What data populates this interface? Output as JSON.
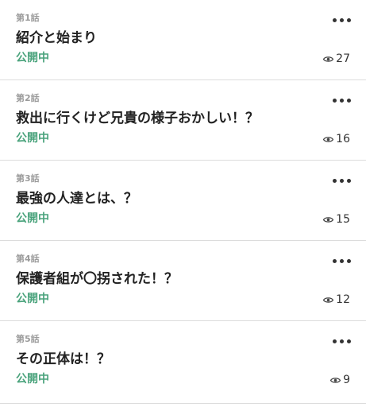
{
  "colors": {
    "status": "#4aa37c",
    "divider": "#dcdcdc",
    "episode_number": "#9b9b9b"
  },
  "icons": {
    "more": "more-horizontal-icon",
    "views": "eye-icon"
  },
  "episodes": [
    {
      "number": "第1話",
      "title": "紹介と始まり",
      "status": "公開中",
      "views": "27"
    },
    {
      "number": "第2話",
      "title": "救出に行くけど兄貴の様子おかしい！？",
      "status": "公開中",
      "views": "16"
    },
    {
      "number": "第3話",
      "title": "最強の人達とは、？",
      "status": "公開中",
      "views": "15"
    },
    {
      "number": "第4話",
      "title": "保護者組が〇拐された！？",
      "status": "公開中",
      "views": "12"
    },
    {
      "number": "第5話",
      "title": "その正体は！？",
      "status": "公開中",
      "views": "9"
    }
  ]
}
